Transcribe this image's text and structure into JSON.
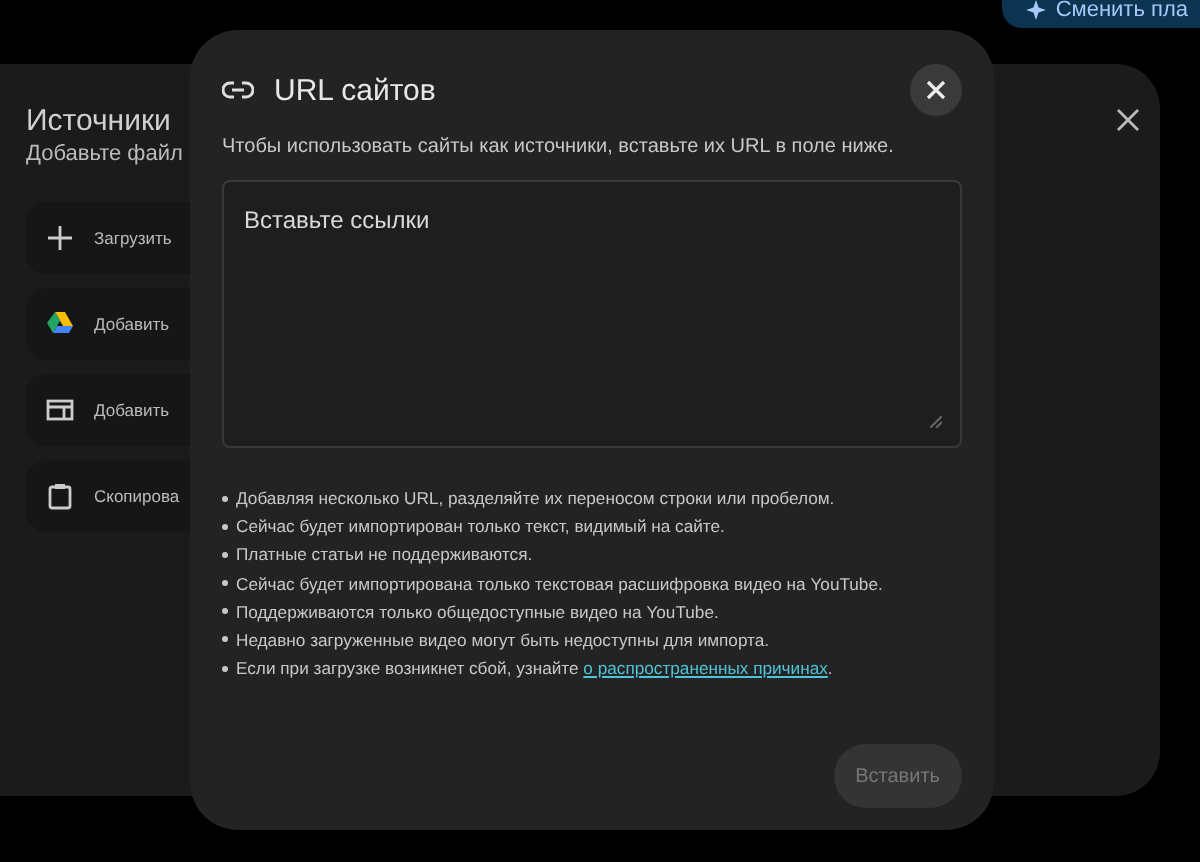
{
  "top_button": {
    "label": "Сменить пла"
  },
  "sources_panel": {
    "title": "Источники",
    "subtitle": "Добавьте файл",
    "items": [
      {
        "kind": "upload",
        "label": "Загрузить"
      },
      {
        "kind": "drive",
        "label": "Добавить"
      },
      {
        "kind": "web",
        "label": "Добавить"
      },
      {
        "kind": "clipboard",
        "label": "Скопирова"
      }
    ]
  },
  "dialog": {
    "title": "URL сайтов",
    "description": "Чтобы использовать сайты как источники, вставьте их URL в поле ниже.",
    "field": {
      "placeholder": "Вставьте ссылки"
    },
    "notes": [
      "Добавляя несколько URL, разделяйте их переносом строки или пробелом.",
      "Сейчас будет импортирован только текст, видимый на сайте.",
      "Платные статьи не поддерживаются.",
      "Сейчас будет импортирована только текстовая расшифровка видео на YouTube.",
      "Поддерживаются только общедоступные видео на YouTube.",
      "Недавно загруженные видео могут быть недоступны для импорта."
    ],
    "last_note": {
      "text": "Если при загрузке возникнет сбой, узнайте ",
      "link": "о распространенных причинах",
      "end": "."
    },
    "submit": {
      "label": "Вставить",
      "disabled": true
    }
  }
}
